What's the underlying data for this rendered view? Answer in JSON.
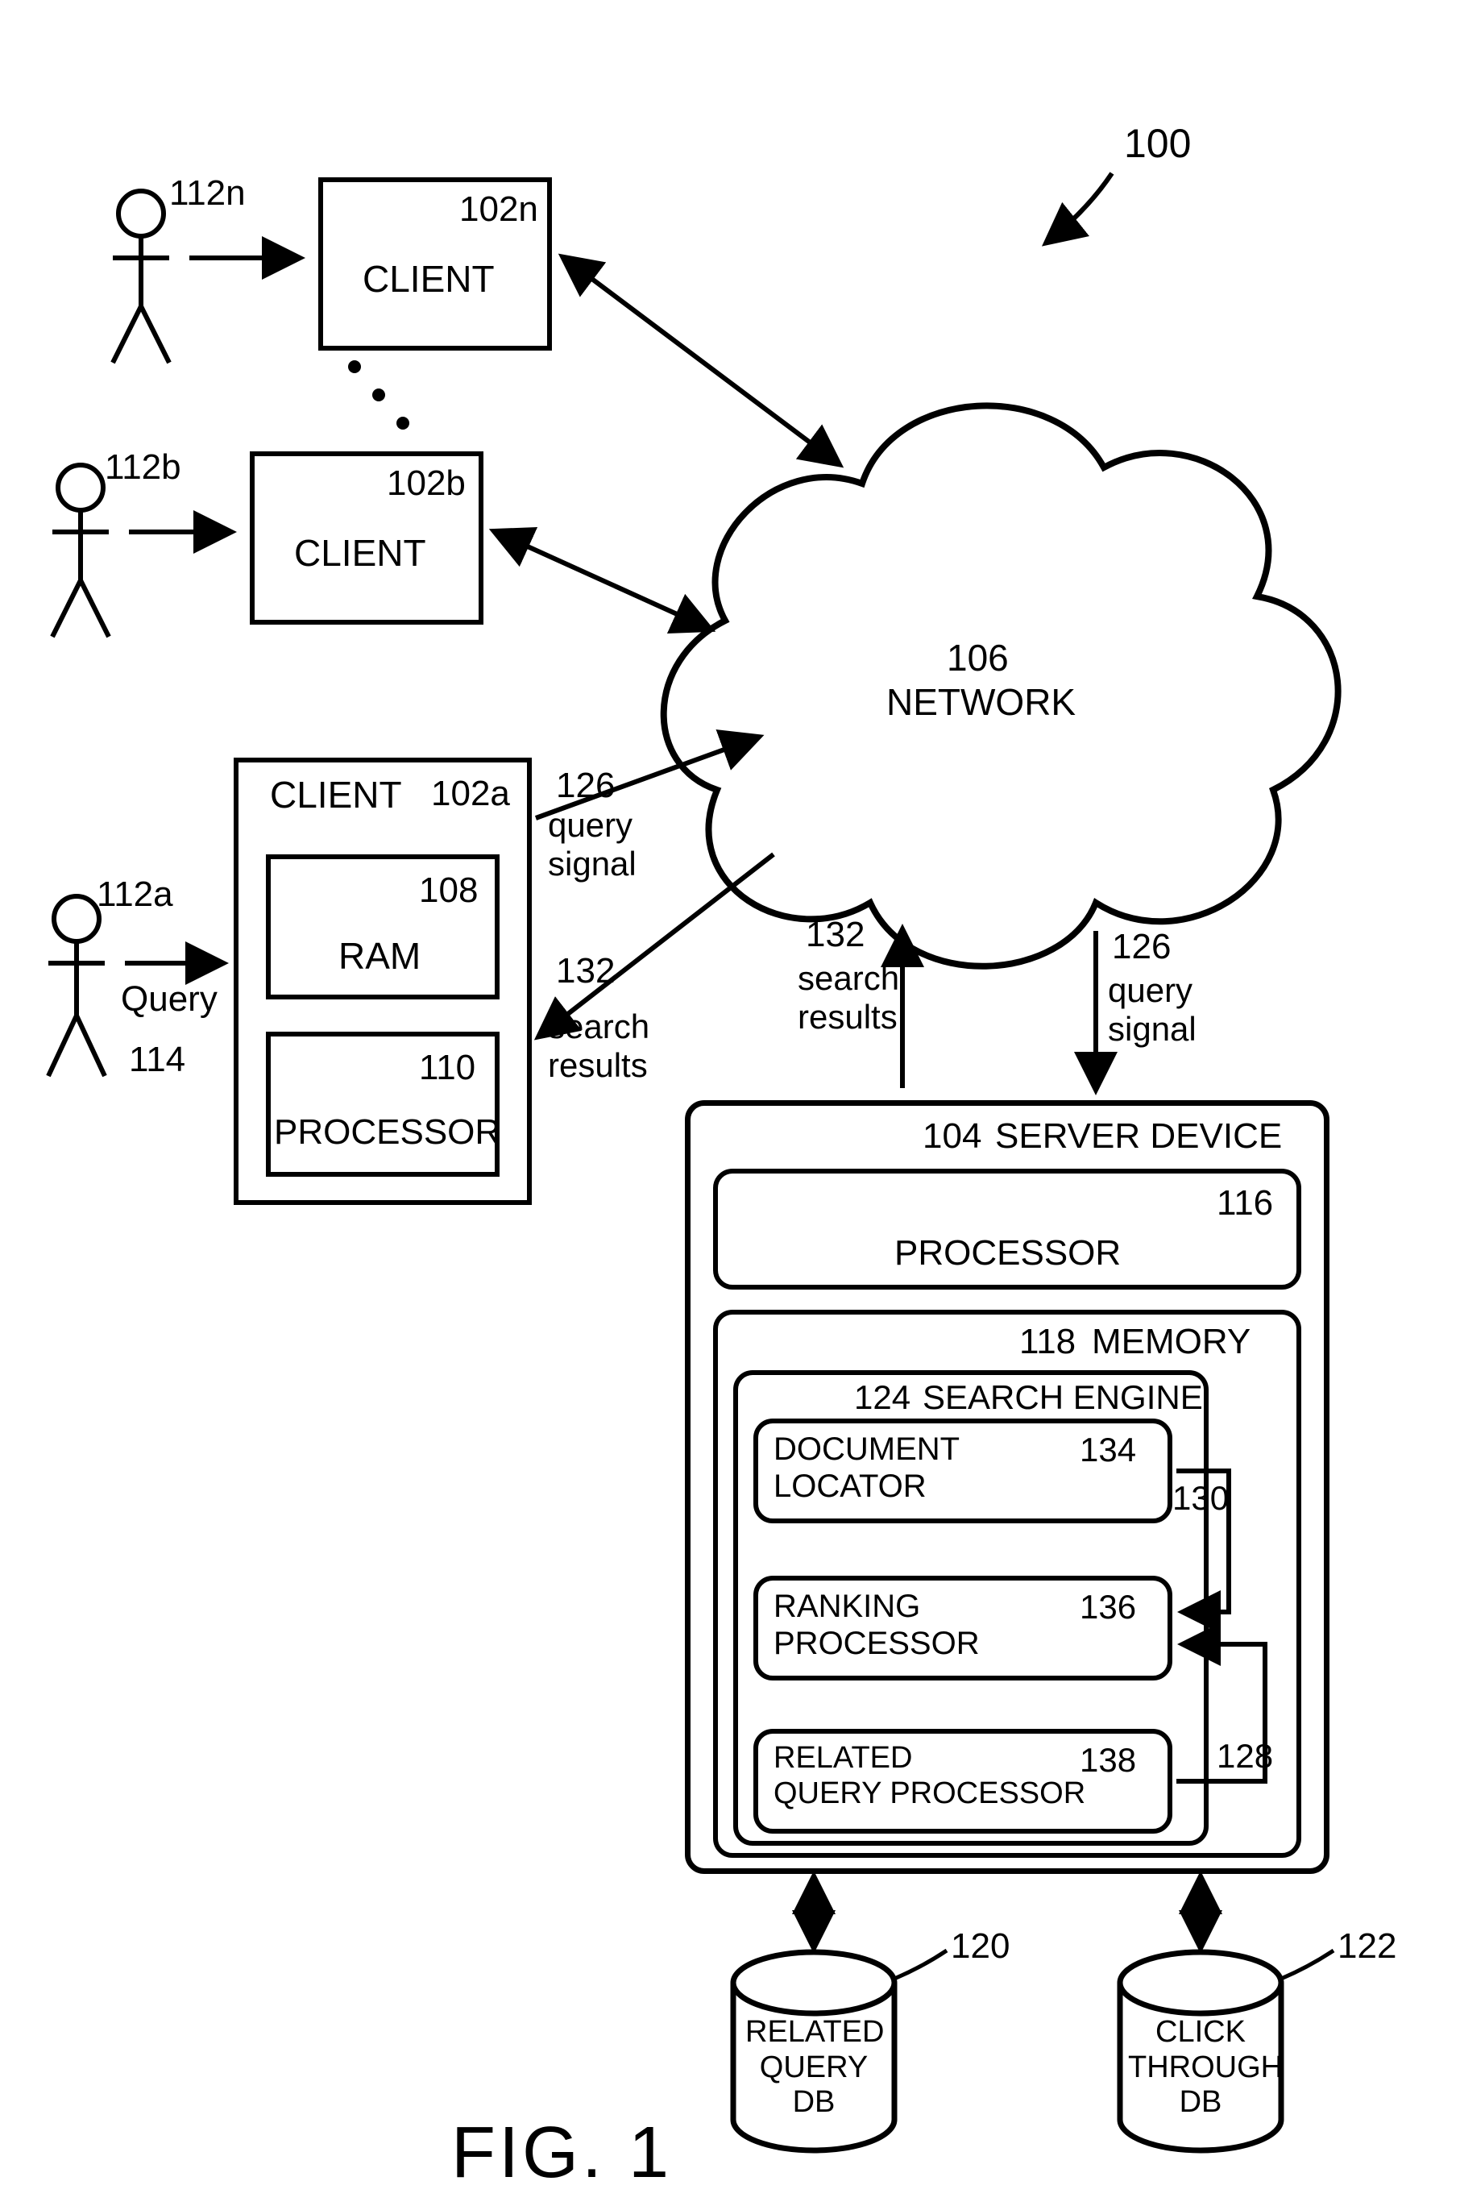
{
  "figure_label": "FIG. 1",
  "refs": {
    "system": "100",
    "client_a": "102a",
    "client_b": "102b",
    "client_n": "102n",
    "server_device": "104",
    "network": "106",
    "ram": "108",
    "processor_client": "110",
    "user_a": "112a",
    "user_b": "112b",
    "user_n": "112n",
    "query": "114",
    "processor_server": "116",
    "memory": "118",
    "related_query_db_ref": "120",
    "click_through_db_ref": "122",
    "search_engine": "124",
    "query_signal": "126",
    "related_query_signal": "128",
    "doc_locator_signal": "130",
    "search_results": "132",
    "document_locator": "134",
    "ranking_processor": "136",
    "related_query_processor": "138"
  },
  "text": {
    "client": "CLIENT",
    "network": "NETWORK",
    "ram": "RAM",
    "processor": "PROCESSOR",
    "query": "Query",
    "query_signal": "query\nsignal",
    "search_results": "search\nresults",
    "server_device": "SERVER DEVICE",
    "memory": "MEMORY",
    "search_engine": "SEARCH ENGINE",
    "document_locator": "DOCUMENT\nLOCATOR",
    "ranking_processor": "RANKING\nPROCESSOR",
    "related_query_processor": "RELATED\nQUERY PROCESSOR",
    "related_query_db": "RELATED\nQUERY\nDB",
    "click_through_db": "CLICK\nTHROUGH\nDB"
  }
}
